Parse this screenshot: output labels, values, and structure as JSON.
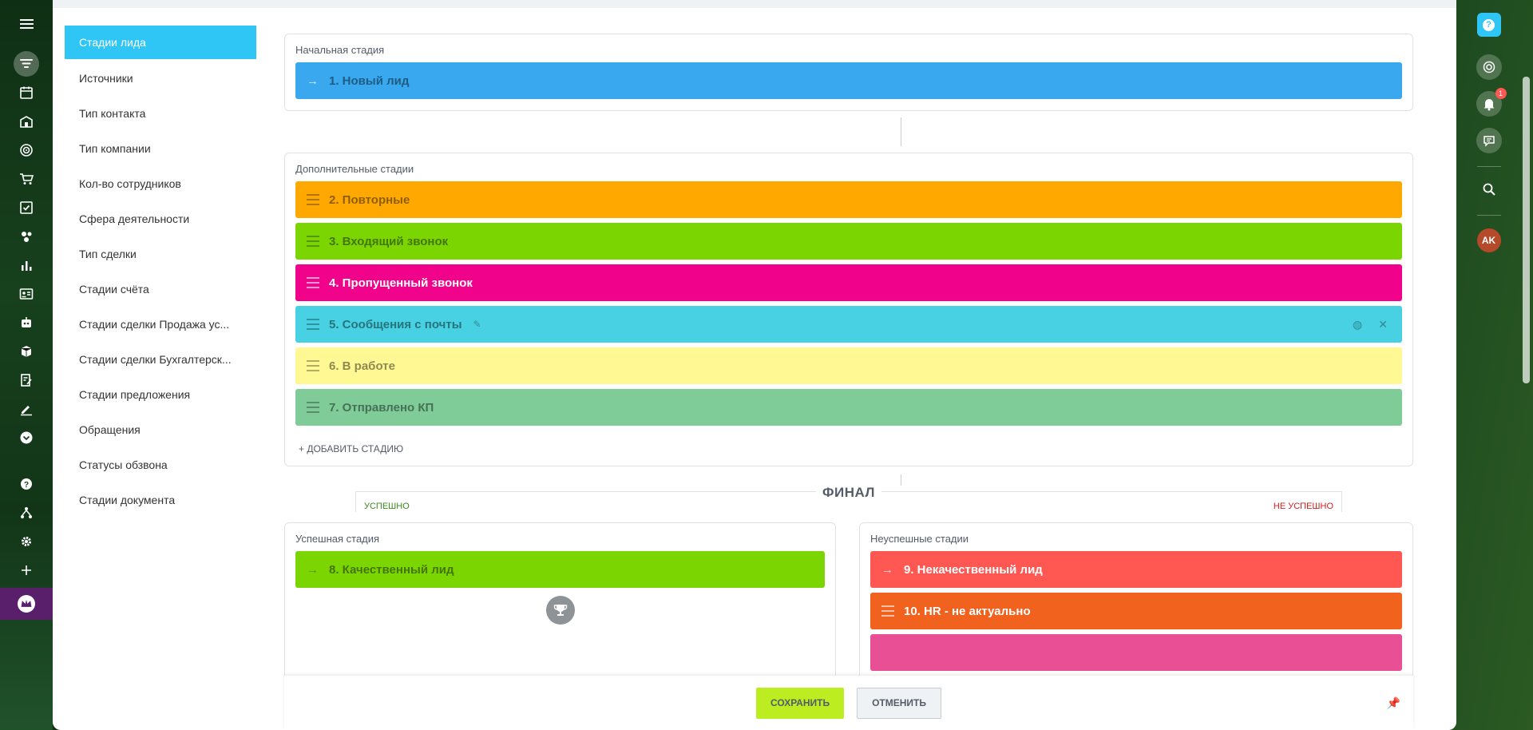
{
  "nav": {
    "items": [
      {
        "label": "Стадии лида",
        "active": true
      },
      {
        "label": "Источники"
      },
      {
        "label": "Тип контакта"
      },
      {
        "label": "Тип компании"
      },
      {
        "label": "Кол-во сотрудников"
      },
      {
        "label": "Сфера деятельности"
      },
      {
        "label": "Тип сделки"
      },
      {
        "label": "Стадии счёта"
      },
      {
        "label": "Стадии сделки Продажа ус..."
      },
      {
        "label": "Стадии сделки Бухгалтерск..."
      },
      {
        "label": "Стадии предложения"
      },
      {
        "label": "Обращения"
      },
      {
        "label": "Статусы обзвона"
      },
      {
        "label": "Стадии документа"
      }
    ]
  },
  "initial": {
    "title": "Начальная стадия",
    "stage": {
      "name": "1. Новый лид",
      "color": "#39a8ef"
    }
  },
  "extra": {
    "title": "Дополнительные стадии",
    "stages": [
      {
        "name": "2. Повторные",
        "color": "#ffa900"
      },
      {
        "name": "3. Входящий звонок",
        "color": "#7bd500"
      },
      {
        "name": "4. Пропущенный звонок",
        "color": "#f0038a"
      },
      {
        "name": "5. Сообщения с почты",
        "color": "#47d1e2"
      },
      {
        "name": "6. В работе",
        "color": "#fff893"
      },
      {
        "name": "7. Отправлено КП",
        "color": "#7fcc98"
      }
    ],
    "add_label": "+ ДОБАВИТЬ СТАДИЮ"
  },
  "final": {
    "title": "ФИНАЛ",
    "success_label": "УСПЕШНО",
    "fail_label": "НЕ УСПЕШНО",
    "success_card": {
      "title": "Успешная стадия",
      "stage": {
        "name": "8. Качественный лид",
        "color": "#7bd500"
      }
    },
    "fail_card": {
      "title": "Неуспешные стадии",
      "stages": [
        {
          "name": "9. Некачественный лид",
          "color": "#ff5752"
        },
        {
          "name": "10. HR - не актуально",
          "color": "#f1621f"
        }
      ]
    }
  },
  "buttons": {
    "save": "СОХРАНИТЬ",
    "cancel": "ОТМЕНИТЬ"
  },
  "rightbar": {
    "notification_count": "1",
    "avatar_initials": "AK"
  },
  "colors": {
    "accent": "#2fc6f6",
    "save_button": "#bbed21",
    "third_fail_stage_peek": "#e84f94"
  }
}
